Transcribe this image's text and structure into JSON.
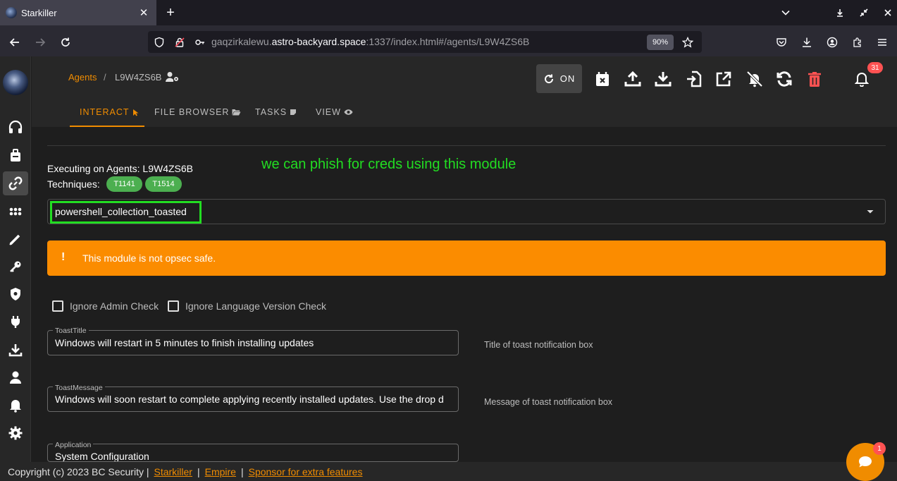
{
  "browser": {
    "tab_title": "Starkiller",
    "url_prefix": "gaqzirkalewu.",
    "url_host": "astro-backyard.space",
    "url_rest": ":1337/index.html#/agents/L9W4ZS6B",
    "zoom": "90%"
  },
  "breadcrumb": {
    "parent": "Agents",
    "separator": "/",
    "current": "L9W4ZS6B"
  },
  "header": {
    "toggle_label": "ON",
    "notification_count": "31"
  },
  "tabs": [
    {
      "label": "INTERACT"
    },
    {
      "label": "FILE BROWSER"
    },
    {
      "label": "TASKS"
    },
    {
      "label": "VIEW"
    }
  ],
  "module": {
    "executing_on": "Executing on Agents: L9W4ZS6B",
    "techniques_label": "Techniques:",
    "techniques": [
      "T1141",
      "T1514"
    ],
    "annotation": "we can phish for creds using this module",
    "selected_module": "powershell_collection_toasted",
    "alert_icon": "!",
    "alert_text": "This module is not opsec safe.",
    "checkboxes": [
      {
        "label": "Ignore Admin Check"
      },
      {
        "label": "Ignore Language Version Check"
      }
    ],
    "fields": [
      {
        "label": "ToastTitle",
        "value": "Windows will restart in 5 minutes to finish installing updates",
        "description": "Title of toast notification box"
      },
      {
        "label": "ToastMessage",
        "value": "Windows will soon restart to complete applying recently installed updates. Use the drop d",
        "description": "Message of toast notification box"
      },
      {
        "label": "Application",
        "value": "System Configuration",
        "description": ""
      }
    ]
  },
  "footer": {
    "copyright": "Copyright (c) 2023 BC Security |",
    "links": [
      "Starkiller",
      "Empire",
      "Sponsor for extra features"
    ],
    "separator": "|"
  },
  "chat": {
    "badge": "1"
  },
  "colors": {
    "accent": "#f08c00",
    "alert": "#fb8c00",
    "chip": "#4caf50",
    "annotation": "#22dd22",
    "danger": "#ff5252"
  }
}
